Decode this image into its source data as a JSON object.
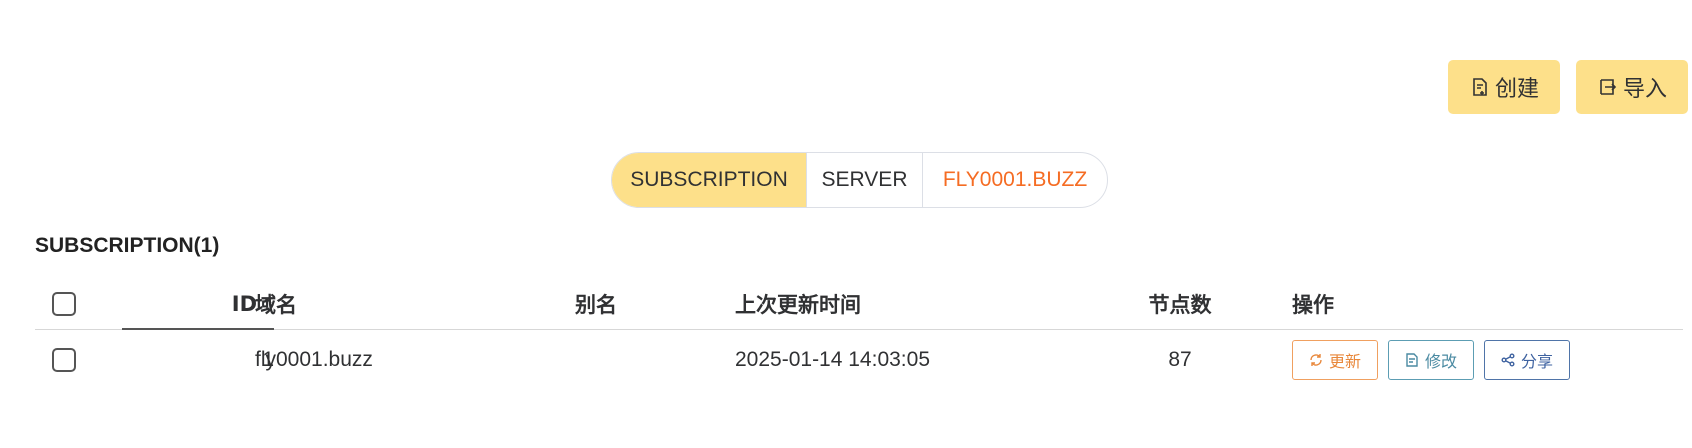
{
  "toolbar": {
    "create_label": "创建",
    "import_label": "导入"
  },
  "segment": {
    "options": [
      "SUBSCRIPTION",
      "SERVER",
      "FLY0001.BUZZ"
    ],
    "selected": "SUBSCRIPTION"
  },
  "section": {
    "title": "SUBSCRIPTION(1)"
  },
  "table": {
    "columns": {
      "id": "ID",
      "domain": "域名",
      "alias": "别名",
      "last_update": "上次更新时间",
      "nodes": "节点数",
      "actions": "操作"
    },
    "sort": {
      "column": "ID",
      "direction": "asc"
    },
    "rows": [
      {
        "id": "1",
        "domain": "fly0001.buzz",
        "alias": "",
        "last_update": "2025-01-14 14:03:05",
        "nodes": "87",
        "actions": {
          "update": "更新",
          "edit": "修改",
          "share": "分享"
        }
      }
    ]
  },
  "colors": {
    "accent": "#fde08a",
    "highlight_text": "#f56c23",
    "update": "#e8873a",
    "edit": "#4a8aa2",
    "share": "#3e62a0"
  },
  "icons": [
    "document-plus-icon",
    "import-icon",
    "sort-up-arrow-icon",
    "refresh-icon",
    "edit-icon",
    "share-icon"
  ]
}
